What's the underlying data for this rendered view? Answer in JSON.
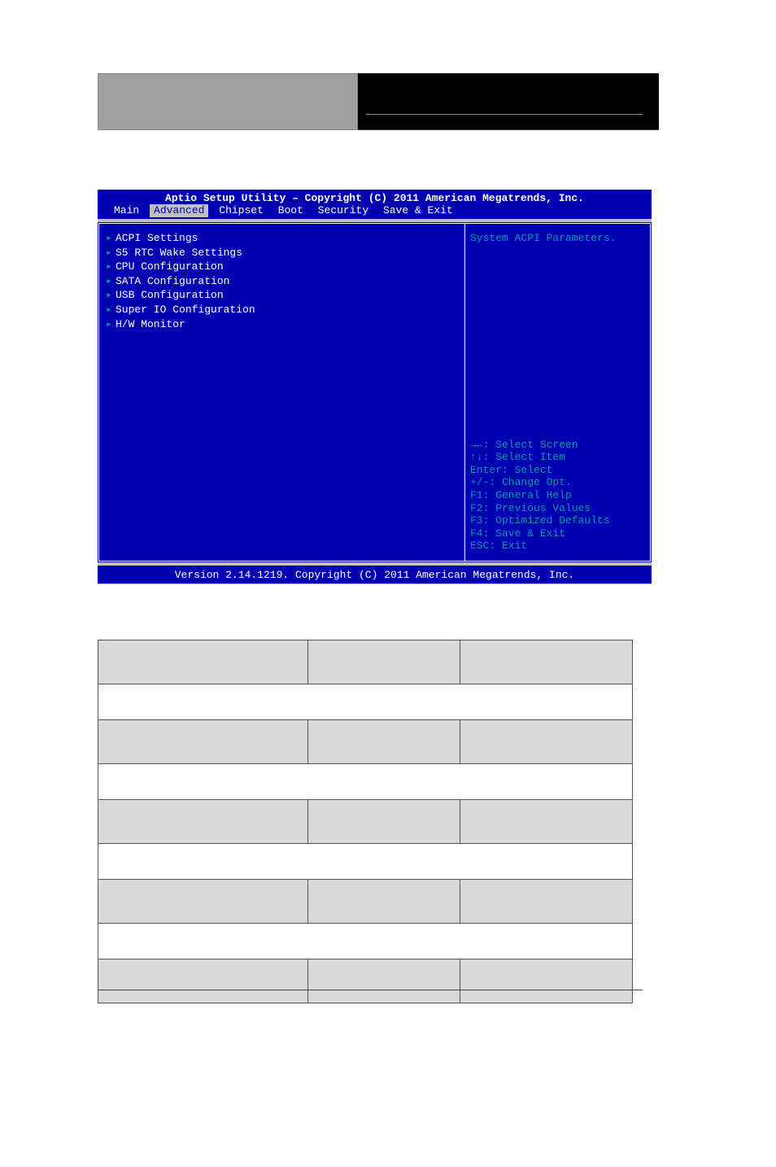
{
  "header": {
    "left_text": "",
    "right_text": ""
  },
  "bios": {
    "title": "Aptio Setup Utility – Copyright (C) 2011 American Megatrends, Inc.",
    "tabs": [
      "Main",
      "Advanced",
      "Chipset",
      "Boot",
      "Security",
      "Save & Exit"
    ],
    "active_tab_index": 1,
    "menu_items": [
      "ACPI Settings",
      "S5 RTC Wake Settings",
      "CPU Configuration",
      "SATA Configuration",
      "USB Configuration",
      "Super IO Configuration",
      "H/W Monitor"
    ],
    "help_top": "System ACPI Parameters.",
    "help_keys": [
      "→←: Select Screen",
      "↑↓: Select Item",
      "Enter: Select",
      "+/-: Change Opt.",
      "F1: General Help",
      "F2: Previous Values",
      "F3: Optimized Defaults",
      "F4: Save & Exit",
      "ESC: Exit"
    ],
    "footer": "Version 2.14.1219. Copyright (C) 2011 American Megatrends, Inc."
  },
  "table": {
    "rows": [
      {
        "type": "grey",
        "cells": [
          "",
          "",
          ""
        ]
      },
      {
        "type": "white",
        "cells": [
          ""
        ]
      },
      {
        "type": "grey",
        "cells": [
          "",
          "",
          ""
        ]
      },
      {
        "type": "white",
        "cells": [
          ""
        ]
      },
      {
        "type": "grey",
        "cells": [
          "",
          "",
          ""
        ]
      },
      {
        "type": "white",
        "cells": [
          ""
        ]
      },
      {
        "type": "grey",
        "cells": [
          "",
          "",
          ""
        ]
      },
      {
        "type": "white",
        "cells": [
          ""
        ]
      },
      {
        "type": "grey",
        "cells": [
          "",
          "",
          ""
        ]
      }
    ]
  }
}
